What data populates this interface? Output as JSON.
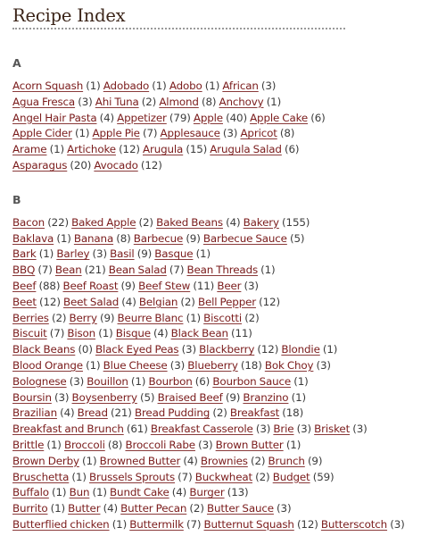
{
  "page": {
    "title": "Recipe Index",
    "link_color": "#7a1b1b",
    "count_color": "#3c3c3c"
  },
  "sections": [
    {
      "letter": "A",
      "rows": [
        [
          {
            "name": "Acorn Squash",
            "count": "(1)"
          },
          {
            "name": "Adobado",
            "count": "(1)"
          },
          {
            "name": "Adobo",
            "count": "(1)"
          },
          {
            "name": "African",
            "count": "(3)"
          }
        ],
        [
          {
            "name": "Agua Fresca",
            "count": "(3)"
          },
          {
            "name": "Ahi Tuna",
            "count": "(2)"
          },
          {
            "name": "Almond",
            "count": "(8)"
          },
          {
            "name": "Anchovy",
            "count": "(1)"
          }
        ],
        [
          {
            "name": "Angel Hair Pasta",
            "count": "(4)"
          },
          {
            "name": "Appetizer",
            "count": "(79)"
          },
          {
            "name": "Apple",
            "count": "(40)"
          },
          {
            "name": "Apple Cake",
            "count": "(6)"
          }
        ],
        [
          {
            "name": "Apple Cider",
            "count": "(1)"
          },
          {
            "name": "Apple Pie",
            "count": "(7)"
          },
          {
            "name": "Applesauce",
            "count": "(3)"
          },
          {
            "name": "Apricot",
            "count": "(8)"
          }
        ],
        [
          {
            "name": "Arame",
            "count": "(1)"
          },
          {
            "name": "Artichoke",
            "count": "(12)"
          },
          {
            "name": "Arugula",
            "count": "(15)"
          },
          {
            "name": "Arugula Salad",
            "count": "(6)"
          }
        ],
        [
          {
            "name": "Asparagus",
            "count": "(20)"
          },
          {
            "name": "Avocado",
            "count": "(12)"
          }
        ]
      ]
    },
    {
      "letter": "B",
      "rows": [
        [
          {
            "name": "Bacon",
            "count": "(22)"
          },
          {
            "name": "Baked Apple",
            "count": "(2)"
          },
          {
            "name": "Baked Beans",
            "count": "(4)"
          },
          {
            "name": "Bakery",
            "count": "(155)"
          }
        ],
        [
          {
            "name": "Baklava",
            "count": "(1)"
          },
          {
            "name": "Banana",
            "count": "(8)"
          },
          {
            "name": "Barbecue",
            "count": "(9)"
          },
          {
            "name": "Barbecue Sauce",
            "count": "(5)"
          }
        ],
        [
          {
            "name": "Bark",
            "count": "(1)"
          },
          {
            "name": "Barley",
            "count": "(3)"
          },
          {
            "name": "Basil",
            "count": "(9)"
          },
          {
            "name": "Basque",
            "count": "(1)"
          }
        ],
        [
          {
            "name": "BBQ",
            "count": "(7)"
          },
          {
            "name": "Bean",
            "count": "(21)"
          },
          {
            "name": "Bean Salad",
            "count": "(7)"
          },
          {
            "name": "Bean Threads",
            "count": "(1)"
          }
        ],
        [
          {
            "name": "Beef",
            "count": "(88)"
          },
          {
            "name": "Beef Roast",
            "count": "(9)"
          },
          {
            "name": "Beef Stew",
            "count": "(11)"
          },
          {
            "name": "Beer",
            "count": "(3)"
          }
        ],
        [
          {
            "name": "Beet",
            "count": "(12)"
          },
          {
            "name": "Beet Salad",
            "count": "(4)"
          },
          {
            "name": "Belgian",
            "count": "(2)"
          },
          {
            "name": "Bell Pepper",
            "count": "(12)"
          }
        ],
        [
          {
            "name": "Berries",
            "count": "(2)"
          },
          {
            "name": "Berry",
            "count": "(9)"
          },
          {
            "name": "Beurre Blanc",
            "count": "(1)"
          },
          {
            "name": "Biscotti",
            "count": "(2)"
          }
        ],
        [
          {
            "name": "Biscuit",
            "count": "(7)"
          },
          {
            "name": "Bison",
            "count": "(1)"
          },
          {
            "name": "Bisque",
            "count": "(4)"
          },
          {
            "name": "Black Bean",
            "count": "(11)"
          }
        ],
        [
          {
            "name": "Black Beans",
            "count": "(0)"
          },
          {
            "name": "Black Eyed Peas",
            "count": "(3)"
          },
          {
            "name": "Blackberry",
            "count": "(12)"
          },
          {
            "name": "Blondie",
            "count": "(1)"
          }
        ],
        [
          {
            "name": "Blood Orange",
            "count": "(1)"
          },
          {
            "name": "Blue Cheese",
            "count": "(3)"
          },
          {
            "name": "Blueberry",
            "count": "(18)"
          },
          {
            "name": "Bok Choy",
            "count": "(3)"
          }
        ],
        [
          {
            "name": "Bolognese",
            "count": "(3)"
          },
          {
            "name": "Bouillon",
            "count": "(1)"
          },
          {
            "name": "Bourbon",
            "count": "(6)"
          },
          {
            "name": "Bourbon Sauce",
            "count": "(1)"
          }
        ],
        [
          {
            "name": "Boursin",
            "count": "(3)"
          },
          {
            "name": "Boysenberry",
            "count": "(5)"
          },
          {
            "name": "Braised Beef",
            "count": "(9)"
          },
          {
            "name": "Branzino",
            "count": "(1)"
          }
        ],
        [
          {
            "name": "Brazilian",
            "count": "(4)"
          },
          {
            "name": "Bread",
            "count": "(21)"
          },
          {
            "name": "Bread Pudding",
            "count": "(2)"
          },
          {
            "name": "Breakfast",
            "count": "(18)"
          }
        ],
        [
          {
            "name": "Breakfast and Brunch",
            "count": "(61)"
          },
          {
            "name": "Breakfast Casserole",
            "count": "(3)"
          },
          {
            "name": "Brie",
            "count": "(3)"
          },
          {
            "name": "Brisket",
            "count": "(3)"
          }
        ],
        [
          {
            "name": "Brittle",
            "count": "(1)"
          },
          {
            "name": "Broccoli",
            "count": "(8)"
          },
          {
            "name": "Broccoli Rabe",
            "count": "(3)"
          },
          {
            "name": "Brown Butter",
            "count": "(1)"
          }
        ],
        [
          {
            "name": "Brown Derby",
            "count": "(1)"
          },
          {
            "name": "Browned Butter",
            "count": "(4)"
          },
          {
            "name": "Brownies",
            "count": "(2)"
          },
          {
            "name": "Brunch",
            "count": "(9)"
          }
        ],
        [
          {
            "name": "Bruschetta",
            "count": "(1)"
          },
          {
            "name": "Brussels Sprouts",
            "count": "(7)"
          },
          {
            "name": "Buckwheat",
            "count": "(2)"
          },
          {
            "name": "Budget",
            "count": "(59)"
          }
        ],
        [
          {
            "name": "Buffalo",
            "count": "(1)"
          },
          {
            "name": "Bun",
            "count": "(1)"
          },
          {
            "name": "Bundt Cake",
            "count": "(4)"
          },
          {
            "name": "Burger",
            "count": "(13)"
          }
        ],
        [
          {
            "name": "Burrito",
            "count": "(1)"
          },
          {
            "name": "Butter",
            "count": "(4)"
          },
          {
            "name": "Butter Pecan",
            "count": "(2)"
          },
          {
            "name": "Butter Sauce",
            "count": "(3)"
          }
        ],
        [
          {
            "name": "Butterflied chicken",
            "count": "(1)"
          },
          {
            "name": "Buttermilk",
            "count": "(7)"
          },
          {
            "name": "Butternut Squash",
            "count": "(12)"
          },
          {
            "name": "Butterscotch",
            "count": "(3)"
          }
        ]
      ]
    }
  ]
}
